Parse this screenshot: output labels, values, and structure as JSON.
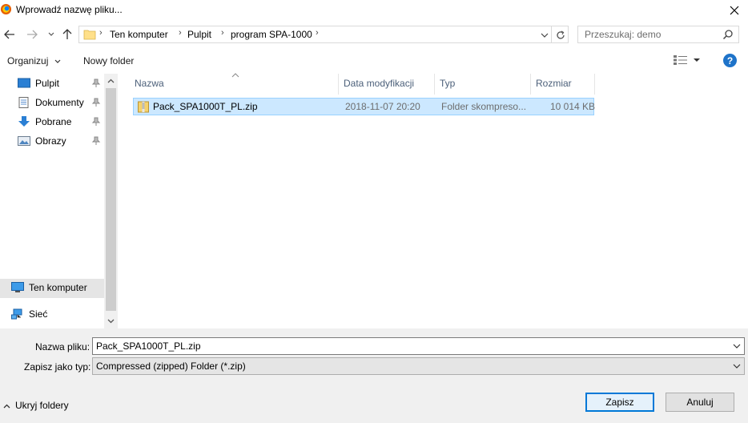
{
  "window": {
    "title": "Wprowadź nazwę pliku..."
  },
  "navigation": {
    "breadcrumb": [
      "Ten komputer",
      "Pulpit",
      "program SPA-1000"
    ],
    "search_placeholder": "Przeszukaj: demo"
  },
  "toolbar": {
    "organize_label": "Organizuj",
    "new_folder_label": "Nowy folder"
  },
  "sidebar": {
    "quick_access": [
      {
        "label": "Pulpit",
        "icon": "desktop-icon",
        "pinned": true
      },
      {
        "label": "Dokumenty",
        "icon": "documents-icon",
        "pinned": true
      },
      {
        "label": "Pobrane",
        "icon": "downloads-icon",
        "pinned": true
      },
      {
        "label": "Obrazy",
        "icon": "pictures-icon",
        "pinned": true
      }
    ],
    "this_pc": "Ten komputer",
    "network": "Sieć"
  },
  "file_list": {
    "columns": [
      "Nazwa",
      "Data modyfikacji",
      "Typ",
      "Rozmiar"
    ],
    "rows": [
      {
        "name": "Pack_SPA1000T_PL.zip",
        "modified": "2018-11-07 20:20",
        "type": "Folder skompreso...",
        "size": "10 014 KB"
      }
    ]
  },
  "form": {
    "filename_label": "Nazwa pliku:",
    "filename_value": "Pack_SPA1000T_PL.zip",
    "filetype_label": "Zapisz jako typ:",
    "filetype_value": "Compressed (zipped) Folder (*.zip)"
  },
  "footer": {
    "hide_folders_label": "Ukryj foldery",
    "save_label": "Zapisz",
    "cancel_label": "Anuluj"
  },
  "colors": {
    "accent": "#0078d7",
    "selection_bg": "#cce8ff",
    "selection_border": "#99d1ff",
    "header_text": "#4c607a"
  }
}
